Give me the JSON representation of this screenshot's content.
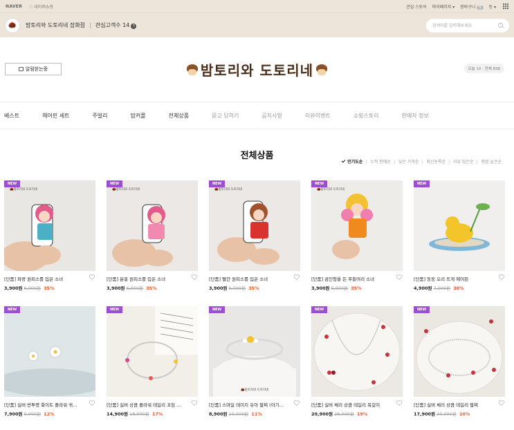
{
  "topbar": {
    "naver": "NAVER",
    "shopping": "네이버쇼핑",
    "links": [
      "관심 스토어",
      "마이페이지",
      "장바구니"
    ],
    "cart_count": "5",
    "more": "등"
  },
  "store": {
    "name": "밤토리와 도토리네 잡화점",
    "fans_label": "관심고객수 14",
    "search_placeholder": "검색어를 입력해보세요"
  },
  "header": {
    "alarm": "알림받는중",
    "brand": "밤토리와 도토리네",
    "counts": "오늘 10 · 전체 838"
  },
  "nav": [
    "베스트",
    "헤어핀 세트",
    "주얼리",
    "맘커플",
    "전체상품",
    "묻고 답하기",
    "공지사항",
    "리뷰이벤트",
    "쇼핑스토리",
    "판매자 정보"
  ],
  "page": {
    "title": "전체상품"
  },
  "sorts": [
    "인기도순",
    "누적 판매순",
    "낮은 가격순",
    "최신등록순",
    "리뷰 많은순",
    "평점 높은순"
  ],
  "badge": "NEW",
  "watermark": "밤토리와 도토리네",
  "products": [
    {
      "name": "[단품] 파랑 원피스를 입은 소녀",
      "price": "3,900원",
      "orig": "6,000원",
      "disc": "35%"
    },
    {
      "name": "[단품] 분홍 원피스를 입은 소녀",
      "price": "3,900원",
      "orig": "6,000원",
      "disc": "35%"
    },
    {
      "name": "[단품] 빨간 원피스를 입은 소녀",
      "price": "3,900원",
      "orig": "6,000원",
      "disc": "35%"
    },
    {
      "name": "[단품] 곰인형을 든 푸들머리 소녀",
      "price": "3,900원",
      "orig": "6,000원",
      "disc": "35%"
    },
    {
      "name": "[단품] 둥둥 오리 뜨게 헤어핀",
      "price": "4,900원",
      "orig": "7,000원",
      "disc": "30%"
    },
    {
      "name": "[단품] 실버 반투명 화이트 플라워 귀...",
      "price": "7,900원",
      "orig": "9,000원",
      "disc": "12%"
    },
    {
      "name": "[단품] 실버 상큼 플라워 데일리 꼬임 ...",
      "price": "14,900원",
      "orig": "18,000원",
      "disc": "17%"
    },
    {
      "name": "[단품] 스마일 데이지 유아 팔찌 (아기...",
      "price": "8,900원",
      "orig": "10,000원",
      "disc": "11%"
    },
    {
      "name": "[단품] 실버 체리 상큼 데일리 목걸이",
      "price": "20,900원",
      "orig": "26,000원",
      "disc": "19%"
    },
    {
      "name": "[단품] 실버 체리 상큼 데일리 팔찌",
      "price": "17,900원",
      "orig": "20,000원",
      "disc": "10%"
    }
  ]
}
